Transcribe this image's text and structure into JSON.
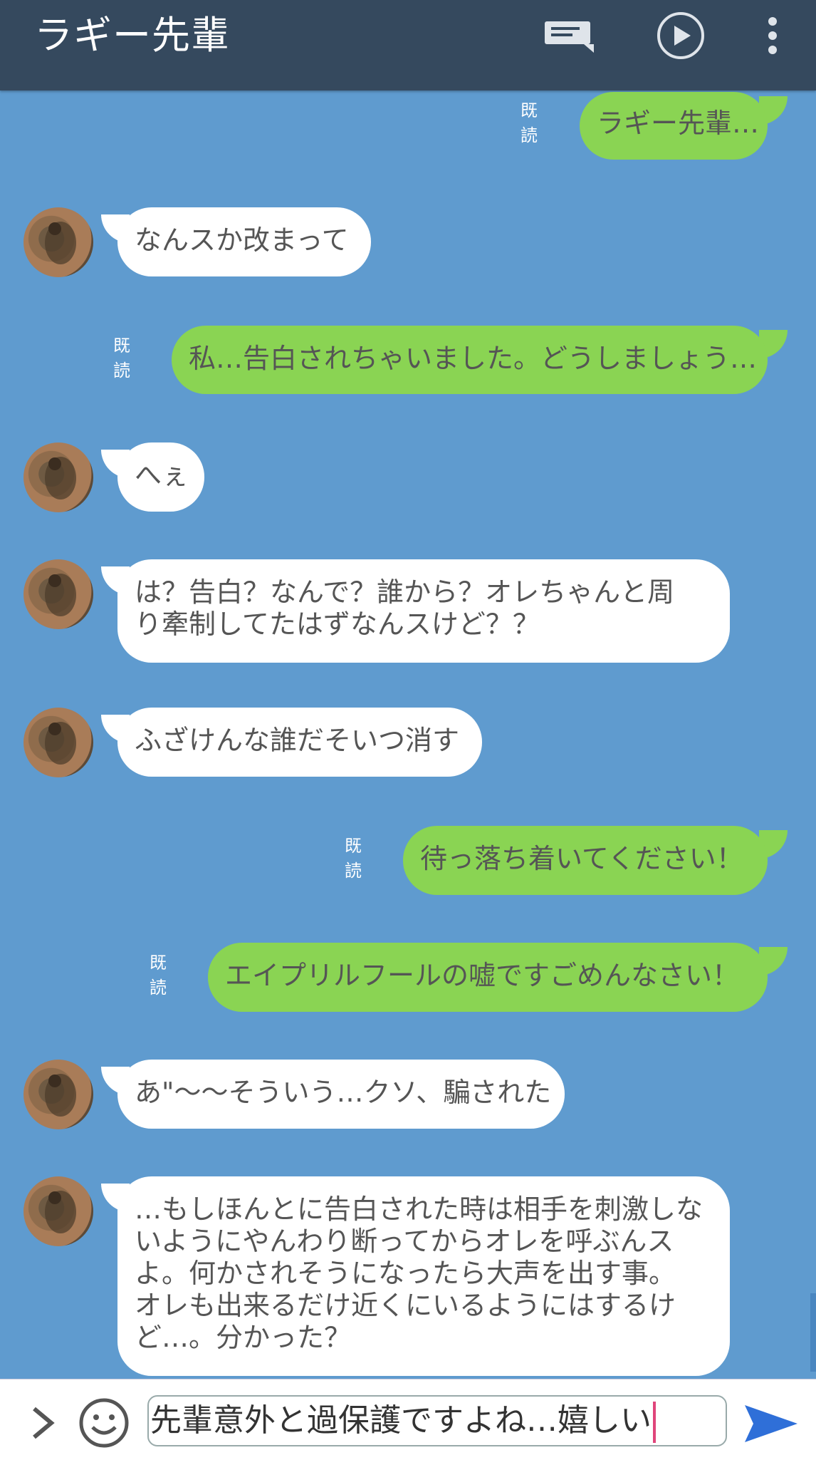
{
  "header": {
    "title": "ラギー先輩",
    "icons": {
      "keyboard": "keyboard-icon",
      "play": "play-circle-icon",
      "menu": "more-vert-icon"
    },
    "bg_color": "#35495e"
  },
  "colors": {
    "chat_bg": "#5f9bcf",
    "outgoing": "#8ad453",
    "incoming": "#ffffff",
    "send": "#2f6fd8"
  },
  "messages": [
    {
      "from": "me",
      "read": "既読",
      "text": "ラギー先輩…"
    },
    {
      "from": "them",
      "text": "なんスか改まって"
    },
    {
      "from": "me",
      "read": "既読",
      "text": "私…告白されちゃいました。どうしましょう…"
    },
    {
      "from": "them",
      "text": "へぇ"
    },
    {
      "from": "them",
      "text": "は？告白？なんで？誰から？オレちゃんと周\nり牽制してたはずなんスけど？？"
    },
    {
      "from": "them",
      "text": "ふざけんな誰だそいつ消す"
    },
    {
      "from": "me",
      "read": "既読",
      "text": "待っ落ち着いてください！"
    },
    {
      "from": "me",
      "read": "既読",
      "text": "エイプリルフールの嘘ですごめんなさい！"
    },
    {
      "from": "them",
      "text": "あ\"〜〜そういう…クソ、騙された"
    },
    {
      "from": "them",
      "text": "…もしほんとに告白された時は相手を刺激しな\nいようにやんわり断ってからオレを呼ぶんス\nよ。何かされそうになったら大声を出す事。\nオレも出来るだけ近くにいるようにはするけ\nど…。分かった？"
    }
  ],
  "input": {
    "value": "先輩意外と過保護ですよね…嬉しい",
    "icons": {
      "expand": "chevron-right-icon",
      "emoji": "emoji-icon",
      "send": "send-icon"
    }
  }
}
